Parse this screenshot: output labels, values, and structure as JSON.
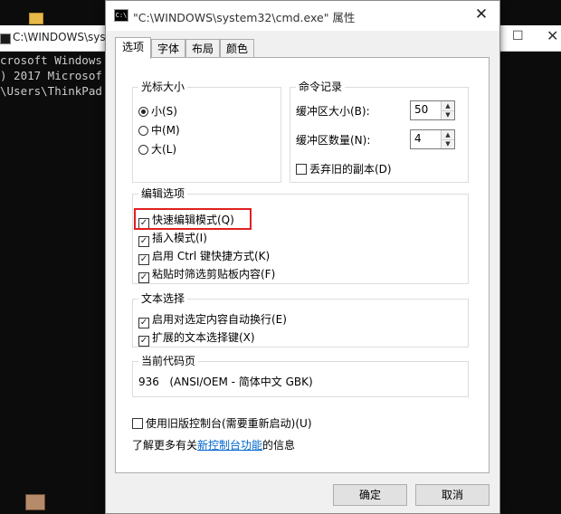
{
  "background": {
    "console_title": "C:\\WINDOWS\\syst",
    "console_lines": [
      "crosoft Windows",
      ") 2017 Microsof",
      "",
      "\\Users\\ThinkPad"
    ],
    "max_glyph": "☐",
    "close_glyph": "✕"
  },
  "dialog": {
    "title": "\"C:\\WINDOWS\\system32\\cmd.exe\" 属性",
    "icon_text": "C:\\",
    "close_glyph": "✕",
    "tabs": [
      {
        "label": "选项",
        "active": true
      },
      {
        "label": "字体",
        "active": false
      },
      {
        "label": "布局",
        "active": false
      },
      {
        "label": "颜色",
        "active": false
      }
    ],
    "cursor_size": {
      "title": "光标大小",
      "options": [
        {
          "label": "小(S)",
          "selected": true
        },
        {
          "label": "中(M)",
          "selected": false
        },
        {
          "label": "大(L)",
          "selected": false
        }
      ]
    },
    "command_history": {
      "title": "命令记录",
      "buffer_size_label": "缓冲区大小(B):",
      "buffer_size_value": "50",
      "buffer_count_label": "缓冲区数量(N):",
      "buffer_count_value": "4",
      "discard_old_label": "丢弃旧的副本(D)",
      "discard_old_checked": false
    },
    "edit_options": {
      "title": "编辑选项",
      "items": [
        {
          "label": "快速编辑模式(Q)",
          "checked": true
        },
        {
          "label": "插入模式(I)",
          "checked": true
        },
        {
          "label": "启用 Ctrl 键快捷方式(K)",
          "checked": true
        },
        {
          "label": "粘贴时筛选剪贴板内容(F)",
          "checked": true
        }
      ]
    },
    "text_selection": {
      "title": "文本选择",
      "items": [
        {
          "label": "启用对选定内容自动换行(E)",
          "checked": true
        },
        {
          "label": "扩展的文本选择键(X)",
          "checked": true
        }
      ]
    },
    "code_page": {
      "title": "当前代码页",
      "value": "936   (ANSI/OEM - 简体中文 GBK)"
    },
    "legacy_console": {
      "label": "使用旧版控制台(需要重新启动)(U)",
      "checked": false
    },
    "learn_more": {
      "prefix": "了解更多有关",
      "link": "新控制台功能",
      "suffix": "的信息"
    },
    "buttons": {
      "ok": "确定",
      "cancel": "取消"
    },
    "check_glyph": "✓",
    "spin_up_glyph": "▲",
    "spin_down_glyph": "▼",
    "highlight_color": "#e02020"
  }
}
